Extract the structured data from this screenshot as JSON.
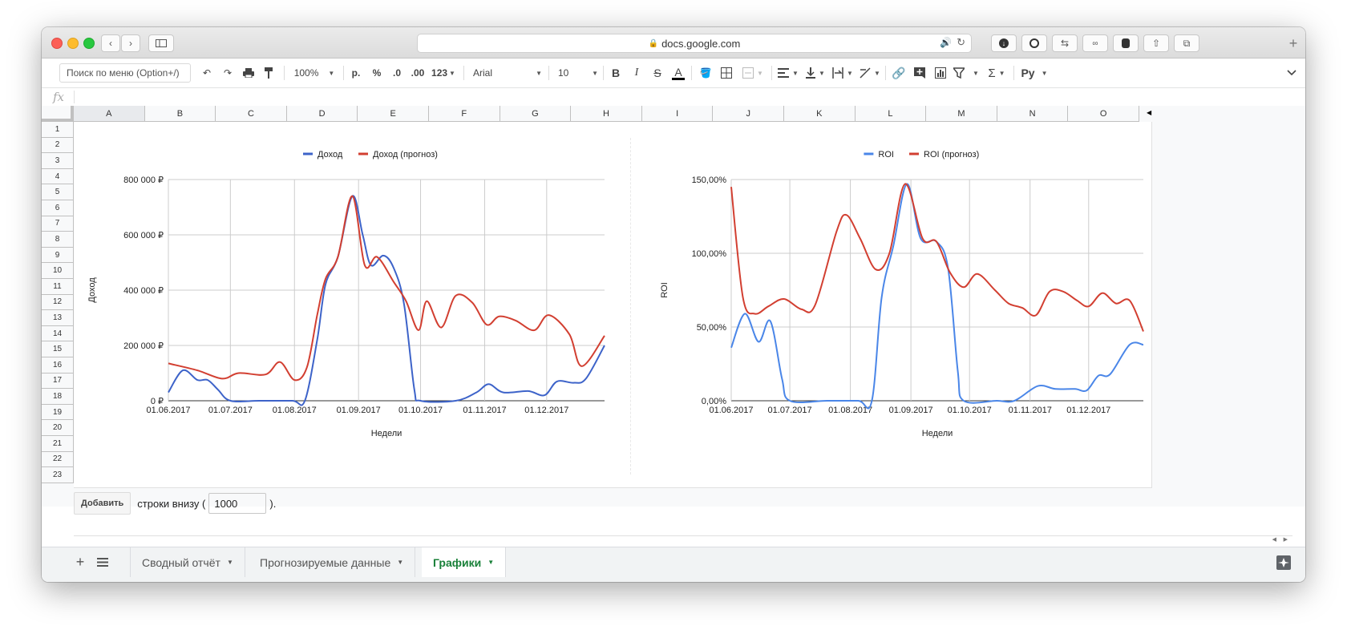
{
  "browser": {
    "url": "docs.google.com"
  },
  "toolbar": {
    "menu_search_placeholder": "Поиск по меню (Option+/)",
    "zoom": "100%",
    "currency_format": "р.",
    "percent_format": "%",
    "decrease_decimals": ".0",
    "increase_decimals": ".00",
    "more_formats": "123",
    "font": "Arial",
    "font_size": "10",
    "bold": "B",
    "italic": "I",
    "strikethrough": "S",
    "text_color": "A",
    "input_tools": "Ру"
  },
  "sheet": {
    "columns": [
      "A",
      "B",
      "C",
      "D",
      "E",
      "F",
      "G",
      "H",
      "I",
      "J",
      "K",
      "L",
      "M",
      "N",
      "O"
    ],
    "rows": [
      "1",
      "2",
      "3",
      "4",
      "5",
      "6",
      "7",
      "8",
      "9",
      "10",
      "11",
      "12",
      "13",
      "14",
      "15",
      "16",
      "17",
      "18",
      "19",
      "20",
      "21",
      "22",
      "23"
    ],
    "add_button": "Добавить",
    "add_text_before": "строки внизу (",
    "add_rows_value": "1000",
    "add_text_after": ")."
  },
  "tabs": [
    {
      "label": "Сводный отчёт"
    },
    {
      "label": "Прогнозируемые данные"
    },
    {
      "label": "Графики"
    }
  ],
  "colors": {
    "series_actual": "#3d63c9",
    "series_forecast": "#d23f31",
    "series_roi": "#4a86e8",
    "active_tab": "#188038"
  },
  "chart_data": [
    {
      "type": "line",
      "xlabel": "Недели",
      "ylabel": "Доход",
      "legend": "top",
      "grid": true,
      "xlim": [
        "2017-06-01",
        "2017-12-29"
      ],
      "ylim": [
        0,
        800000
      ],
      "yticks": [
        "0 ₽",
        "200 000 ₽",
        "400 000 ₽",
        "600 000 ₽",
        "800 000 ₽"
      ],
      "xticks": [
        "01.06.2017",
        "01.07.2017",
        "01.08.2017",
        "01.09.2017",
        "01.10.2017",
        "01.11.2017",
        "01.12.2017"
      ],
      "series": [
        {
          "name": "Доход",
          "points": [
            [
              "2017-06-01",
              30000
            ],
            [
              "2017-06-08",
              110000
            ],
            [
              "2017-06-15",
              75000
            ],
            [
              "2017-06-20",
              75000
            ],
            [
              "2017-06-25",
              40000
            ],
            [
              "2017-07-01",
              0
            ],
            [
              "2017-07-15",
              0
            ],
            [
              "2017-07-31",
              0
            ],
            [
              "2017-08-06",
              0
            ],
            [
              "2017-08-12",
              220000
            ],
            [
              "2017-08-16",
              420000
            ],
            [
              "2017-08-22",
              520000
            ],
            [
              "2017-08-29",
              740000
            ],
            [
              "2017-09-03",
              600000
            ],
            [
              "2017-09-07",
              490000
            ],
            [
              "2017-09-13",
              525000
            ],
            [
              "2017-09-18",
              480000
            ],
            [
              "2017-09-23",
              350000
            ],
            [
              "2017-09-28",
              40000
            ],
            [
              "2017-10-01",
              0
            ],
            [
              "2017-10-18",
              0
            ],
            [
              "2017-10-28",
              30000
            ],
            [
              "2017-11-03",
              60000
            ],
            [
              "2017-11-10",
              30000
            ],
            [
              "2017-11-22",
              35000
            ],
            [
              "2017-11-30",
              20000
            ],
            [
              "2017-12-06",
              70000
            ],
            [
              "2017-12-14",
              65000
            ],
            [
              "2017-12-20",
              80000
            ],
            [
              "2017-12-29",
              200000
            ]
          ]
        },
        {
          "name": "Доход (прогноз)",
          "points": [
            [
              "2017-06-01",
              135000
            ],
            [
              "2017-06-15",
              110000
            ],
            [
              "2017-06-27",
              80000
            ],
            [
              "2017-07-05",
              100000
            ],
            [
              "2017-07-18",
              95000
            ],
            [
              "2017-07-25",
              140000
            ],
            [
              "2017-08-01",
              75000
            ],
            [
              "2017-08-07",
              120000
            ],
            [
              "2017-08-12",
              310000
            ],
            [
              "2017-08-16",
              440000
            ],
            [
              "2017-08-22",
              520000
            ],
            [
              "2017-08-29",
              740000
            ],
            [
              "2017-09-04",
              490000
            ],
            [
              "2017-09-10",
              520000
            ],
            [
              "2017-09-18",
              430000
            ],
            [
              "2017-09-24",
              360000
            ],
            [
              "2017-09-30",
              255000
            ],
            [
              "2017-10-04",
              360000
            ],
            [
              "2017-10-11",
              265000
            ],
            [
              "2017-10-18",
              380000
            ],
            [
              "2017-10-26",
              355000
            ],
            [
              "2017-11-02",
              275000
            ],
            [
              "2017-11-08",
              305000
            ],
            [
              "2017-11-16",
              290000
            ],
            [
              "2017-11-25",
              255000
            ],
            [
              "2017-12-02",
              310000
            ],
            [
              "2017-12-12",
              240000
            ],
            [
              "2017-12-18",
              125000
            ],
            [
              "2017-12-29",
              235000
            ]
          ]
        }
      ]
    },
    {
      "type": "line",
      "xlabel": "Недели",
      "ylabel": "ROI",
      "legend": "top",
      "grid": true,
      "xlim": [
        "2017-06-01",
        "2017-12-29"
      ],
      "ylim": [
        0,
        150
      ],
      "yticks": [
        "0,00%",
        "50,00%",
        "100,00%",
        "150,00%"
      ],
      "xticks": [
        "01.06.2017",
        "01.07.2017",
        "01.08.2017",
        "01.09.2017",
        "01.10.2017",
        "01.11.2017",
        "01.12.2017"
      ],
      "series": [
        {
          "name": "ROI",
          "points": [
            [
              "2017-06-01",
              36
            ],
            [
              "2017-06-08",
              59
            ],
            [
              "2017-06-15",
              40
            ],
            [
              "2017-06-21",
              54
            ],
            [
              "2017-06-27",
              15
            ],
            [
              "2017-07-01",
              0
            ],
            [
              "2017-07-20",
              0
            ],
            [
              "2017-08-05",
              0
            ],
            [
              "2017-08-12",
              0
            ],
            [
              "2017-08-17",
              70
            ],
            [
              "2017-08-23",
              105
            ],
            [
              "2017-08-30",
              147
            ],
            [
              "2017-09-06",
              110
            ],
            [
              "2017-09-14",
              108
            ],
            [
              "2017-09-20",
              90
            ],
            [
              "2017-09-25",
              20
            ],
            [
              "2017-09-28",
              0
            ],
            [
              "2017-10-15",
              0
            ],
            [
              "2017-10-24",
              0
            ],
            [
              "2017-11-05",
              10
            ],
            [
              "2017-11-14",
              8
            ],
            [
              "2017-11-24",
              8
            ],
            [
              "2017-11-30",
              7
            ],
            [
              "2017-12-06",
              17
            ],
            [
              "2017-12-12",
              18
            ],
            [
              "2017-12-22",
              38
            ],
            [
              "2017-12-29",
              38
            ]
          ]
        },
        {
          "name": "ROI (прогноз)",
          "points": [
            [
              "2017-06-01",
              145
            ],
            [
              "2017-06-07",
              70
            ],
            [
              "2017-06-13",
              59
            ],
            [
              "2017-06-20",
              64
            ],
            [
              "2017-06-28",
              69
            ],
            [
              "2017-07-07",
              62
            ],
            [
              "2017-07-14",
              65
            ],
            [
              "2017-07-25",
              115
            ],
            [
              "2017-07-30",
              126
            ],
            [
              "2017-08-06",
              110
            ],
            [
              "2017-08-14",
              89
            ],
            [
              "2017-08-21",
              100
            ],
            [
              "2017-08-29",
              147
            ],
            [
              "2017-09-07",
              110
            ],
            [
              "2017-09-14",
              108
            ],
            [
              "2017-09-21",
              87
            ],
            [
              "2017-09-28",
              77
            ],
            [
              "2017-10-05",
              86
            ],
            [
              "2017-10-14",
              75
            ],
            [
              "2017-10-21",
              66
            ],
            [
              "2017-10-28",
              63
            ],
            [
              "2017-11-04",
              58
            ],
            [
              "2017-11-11",
              74
            ],
            [
              "2017-11-18",
              74
            ],
            [
              "2017-11-25",
              68
            ],
            [
              "2017-12-01",
              64
            ],
            [
              "2017-12-08",
              73
            ],
            [
              "2017-12-15",
              66
            ],
            [
              "2017-12-22",
              68
            ],
            [
              "2017-12-29",
              47
            ]
          ]
        }
      ]
    }
  ]
}
